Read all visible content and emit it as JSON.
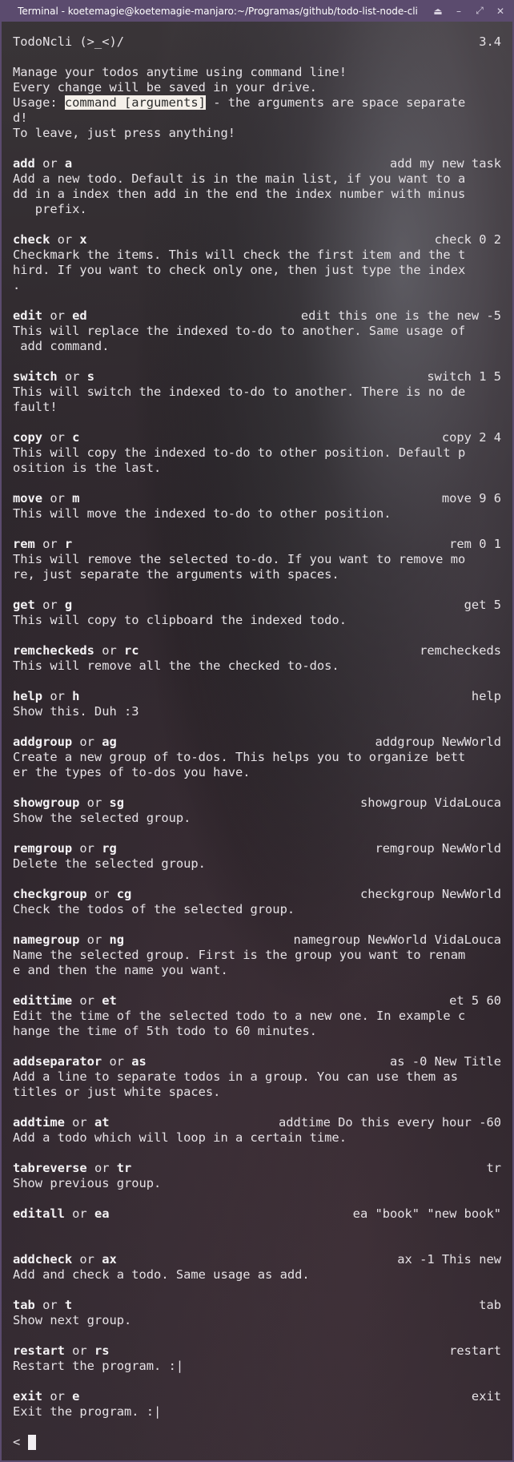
{
  "window": {
    "title": "Terminal - koetemagie@koetemagie-manjaro:~/Programas/github/todo-list-node-cli",
    "controls": [
      "⏏",
      "–",
      "⤢",
      "✕"
    ]
  },
  "header": {
    "app_name": "TodoNcli (>_<)/",
    "version": "3.4"
  },
  "intro": {
    "line1": "Manage your todos anytime using command line!",
    "line2": "Every change will be saved in your drive.",
    "usage_prefix": "Usage: ",
    "usage_highlight": "command [arguments]",
    "usage_suffix": " - the arguments are space separate",
    "usage_wrap": "d!",
    "leave": "To leave, just press anything!"
  },
  "commands": [
    {
      "name": "add",
      "alias": "a",
      "example": "add my new task",
      "desc": [
        "Add a new todo. Default is in the main list, if you want to a",
        "dd in a index then add in the end the index number with minus",
        "   prefix."
      ]
    },
    {
      "name": "check",
      "alias": "x",
      "example": "check 0 2",
      "desc": [
        "Checkmark the items. This will check the first item and the t",
        "hird. If you want to check only one, then just type the index",
        "."
      ]
    },
    {
      "name": "edit",
      "alias": "ed",
      "example": "edit this one is the new -5",
      "desc": [
        "This will replace the indexed to-do to another. Same usage of",
        " add command."
      ]
    },
    {
      "name": "switch",
      "alias": "s",
      "example": "switch 1 5",
      "desc": [
        "This will switch the indexed to-do to another. There is no de",
        "fault!"
      ]
    },
    {
      "name": "copy",
      "alias": "c",
      "example": "copy 2 4",
      "desc": [
        "This will copy the indexed to-do to other position. Default p",
        "osition is the last."
      ]
    },
    {
      "name": "move",
      "alias": "m",
      "example": "move 9 6",
      "desc": [
        "This will move the indexed to-do to other position."
      ]
    },
    {
      "name": "rem",
      "alias": "r",
      "example": "rem 0 1",
      "desc": [
        "This will remove the selected to-do. If you want to remove mo",
        "re, just separate the arguments with spaces."
      ]
    },
    {
      "name": "get",
      "alias": "g",
      "example": "get 5",
      "desc": [
        "This will copy to clipboard the indexed todo."
      ]
    },
    {
      "name": "remcheckeds",
      "alias": "rc",
      "example": "remcheckeds",
      "desc": [
        "This will remove all the the checked to-dos."
      ]
    },
    {
      "name": "help",
      "alias": "h",
      "example": "help",
      "desc": [
        "Show this. Duh :3"
      ]
    },
    {
      "name": "addgroup",
      "alias": "ag",
      "example": "addgroup NewWorld",
      "desc": [
        "Create a new group of to-dos. This helps you to organize bett",
        "er the types of to-dos you have."
      ]
    },
    {
      "name": "showgroup",
      "alias": "sg",
      "example": "showgroup VidaLouca",
      "desc": [
        "Show the selected group."
      ]
    },
    {
      "name": "remgroup",
      "alias": "rg",
      "example": "remgroup NewWorld",
      "desc": [
        "Delete the selected group."
      ]
    },
    {
      "name": "checkgroup",
      "alias": "cg",
      "example": "checkgroup NewWorld",
      "desc": [
        "Check the todos of the selected group."
      ]
    },
    {
      "name": "namegroup",
      "alias": "ng",
      "example": "namegroup NewWorld VidaLouca",
      "desc": [
        "Name the selected group. First is the group you want to renam",
        "e and then the name you want."
      ]
    },
    {
      "name": "edittime",
      "alias": "et",
      "example": "et 5 60",
      "desc": [
        "Edit the time of the selected todo to a new one. In example c",
        "hange the time of 5th todo to 60 minutes."
      ]
    },
    {
      "name": "addseparator",
      "alias": "as",
      "example": "as -0 New Title",
      "desc": [
        "Add a line to separate todos in a group. You can use them as",
        "titles or just white spaces."
      ]
    },
    {
      "name": "addtime",
      "alias": "at",
      "example": "addtime Do this every hour -60",
      "desc": [
        "Add a todo which will loop in a certain time."
      ]
    },
    {
      "name": "tabreverse",
      "alias": "tr",
      "example": "tr",
      "desc": [
        "Show previous group."
      ]
    },
    {
      "name": "editall",
      "alias": "ea",
      "example": "ea \"book\" \"new book\"",
      "desc": [
        ""
      ]
    },
    {
      "name": "addcheck",
      "alias": "ax",
      "example": "ax -1 This new",
      "desc": [
        "Add and check a todo. Same usage as add."
      ]
    },
    {
      "name": "tab",
      "alias": "t",
      "example": "tab",
      "desc": [
        "Show next group."
      ]
    },
    {
      "name": "restart",
      "alias": "rs",
      "example": "restart",
      "desc": [
        "Restart the program. :|"
      ]
    },
    {
      "name": "exit",
      "alias": "e",
      "example": "exit",
      "desc": [
        "Exit the program. :|"
      ]
    }
  ],
  "or_word": " or ",
  "prompt": {
    "symbol": "< "
  },
  "colors": {
    "titlebar": "#5b4b6e",
    "text": "#e6e2e6",
    "highlight_bg": "#f5f0ea"
  }
}
